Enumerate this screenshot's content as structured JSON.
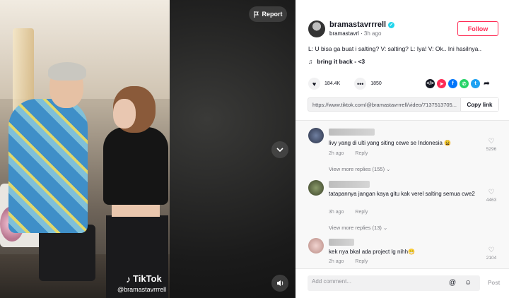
{
  "video": {
    "watermark_logo": "TikTok",
    "watermark_handle": "@bramastavrrrell",
    "report_label": "Report"
  },
  "author": {
    "username": "bramastavrrrell",
    "nickname": "bramastavrl",
    "time_ago": "3h ago",
    "follow_label": "Follow"
  },
  "post": {
    "caption": "L: U bisa ga buat i salting? V: salting? L: Iya! V: Ok.. Ini hasilnya..",
    "music": "bring it back - <3",
    "likes": "184.4K",
    "comments": "1850",
    "share_icons": [
      "embed-icon",
      "send-icon",
      "facebook-icon",
      "whatsapp-icon",
      "twitter-icon",
      "share-arrow-icon"
    ],
    "share_colors": [
      "#161823",
      "#fe2c55",
      "#0075fa",
      "#25d366",
      "#1da1f2",
      "#161823"
    ],
    "link": "https://www.tiktok.com/@bramastavrrrell/video/7137513705...",
    "copy_label": "Copy link"
  },
  "comments": [
    {
      "text": "livy yang di ulti yang siting cewe se Indonesia 😩",
      "time": "2h ago",
      "reply_label": "Reply",
      "likes": "5296",
      "view_replies": "View more replies (155)"
    },
    {
      "text": "tatapannya jangan kaya gitu kak verel salting semua cwe2",
      "time": "3h ago",
      "reply_label": "Reply",
      "likes": "4463",
      "view_replies": "View more replies (13)"
    },
    {
      "text": "kek nya bkal ada project lg nihh😁",
      "time": "2h ago",
      "reply_label": "Reply",
      "likes": "2104"
    }
  ],
  "add_comment": {
    "placeholder": "Add comment...",
    "post_label": "Post"
  }
}
